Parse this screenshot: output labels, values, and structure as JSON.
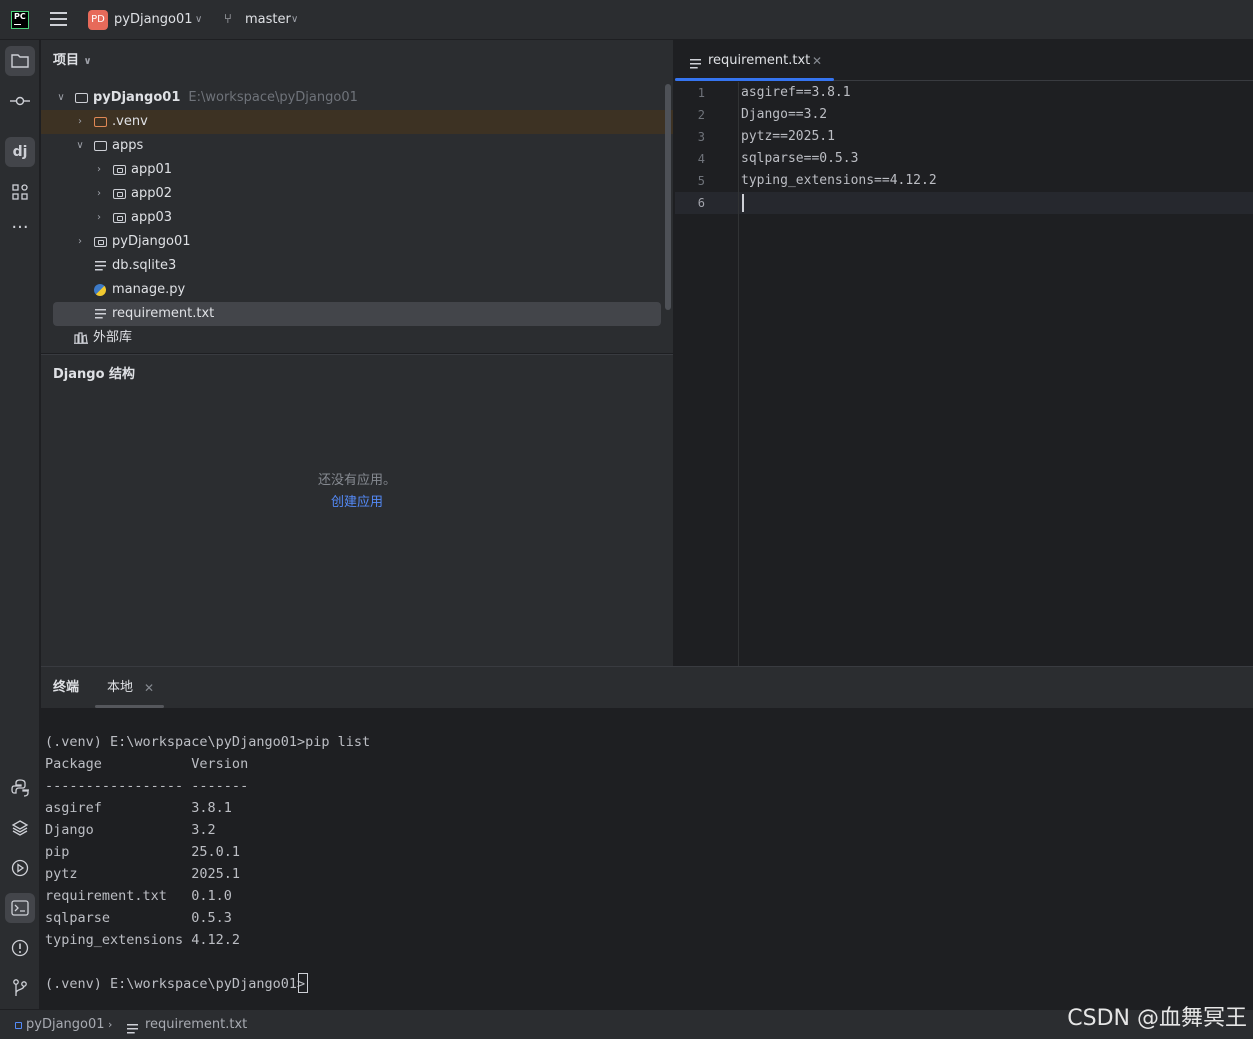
{
  "titlebar": {
    "project_badge": "PD",
    "project_name": "pyDjango01",
    "branch": "master"
  },
  "project_panel": {
    "header": "项目",
    "root": {
      "name": "pyDjango01",
      "path": "E:\\workspace\\pyDjango01"
    },
    "items": [
      {
        "label": ".venv"
      },
      {
        "label": "apps"
      },
      {
        "label": "app01"
      },
      {
        "label": "app02"
      },
      {
        "label": "app03"
      },
      {
        "label": "pyDjango01"
      },
      {
        "label": "db.sqlite3"
      },
      {
        "label": "manage.py"
      },
      {
        "label": "requirement.txt"
      },
      {
        "label": "外部库"
      }
    ]
  },
  "django_panel": {
    "header": "Django 结构",
    "empty_text": "还没有应用。",
    "create_link": "创建应用"
  },
  "editor": {
    "tab_label": "requirement.txt",
    "line_numbers": [
      "1",
      "2",
      "3",
      "4",
      "5",
      "6"
    ],
    "lines": [
      "asgiref==3.8.1",
      "Django==3.2",
      "pytz==2025.1",
      "sqlparse==0.5.3",
      "typing_extensions==4.12.2",
      ""
    ]
  },
  "terminal": {
    "tab_title": "终端",
    "tab_local": "本地",
    "lines": [
      "(.venv) E:\\workspace\\pyDjango01>pip list",
      "Package           Version",
      "----------------- -------",
      "asgiref           3.8.1",
      "Django            3.2",
      "pip               25.0.1",
      "pytz              2025.1",
      "requirement.txt   0.1.0",
      "sqlparse          0.5.3",
      "typing_extensions 4.12.2",
      "",
      "(.venv) E:\\workspace\\pyDjango01>"
    ]
  },
  "statusbar": {
    "project": "pyDjango01",
    "file": "requirement.txt"
  },
  "watermark": "CSDN @血舞冥王"
}
